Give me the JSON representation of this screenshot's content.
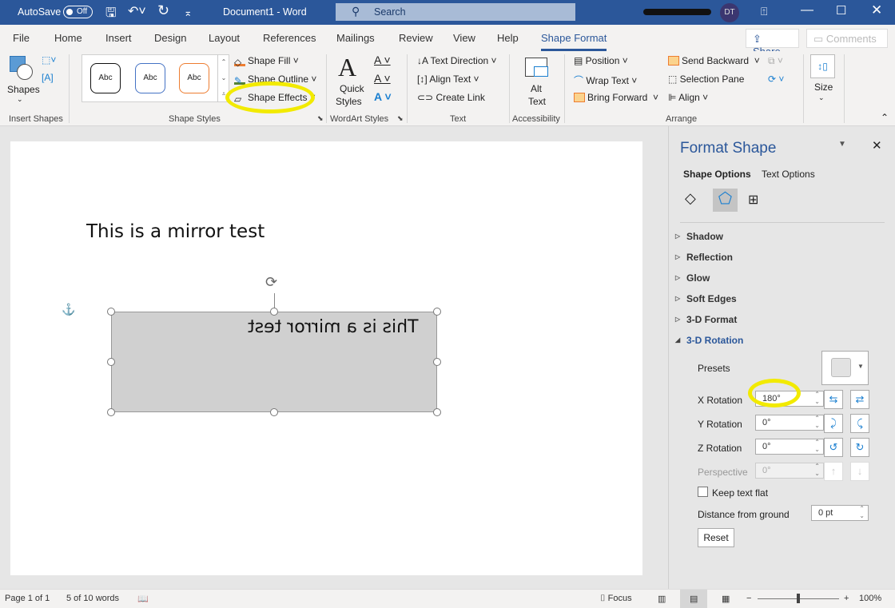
{
  "titlebar": {
    "autosave": "AutoSave",
    "autosave_state": "Off",
    "doc_title": "Document1  -  Word",
    "search_placeholder": "Search",
    "user_initials": "DT"
  },
  "tabs": [
    {
      "label": "File"
    },
    {
      "label": "Home"
    },
    {
      "label": "Insert"
    },
    {
      "label": "Design"
    },
    {
      "label": "Layout"
    },
    {
      "label": "References"
    },
    {
      "label": "Mailings"
    },
    {
      "label": "Review"
    },
    {
      "label": "View"
    },
    {
      "label": "Help"
    },
    {
      "label": "Shape Format",
      "active": true
    }
  ],
  "share": "Share",
  "comments": "Comments",
  "ribbon": {
    "insert_shapes": {
      "shapes": "Shapes",
      "group": "Insert Shapes"
    },
    "shape_styles": {
      "samples": [
        "Abc",
        "Abc",
        "Abc"
      ],
      "fill": "Shape Fill",
      "outline": "Shape Outline",
      "effects": "Shape Effects",
      "group": "Shape Styles"
    },
    "wordart": {
      "quick_styles_1": "Quick",
      "quick_styles_2": "Styles",
      "group": "WordArt Styles"
    },
    "text": {
      "direction": "Text Direction",
      "align": "Align Text",
      "link": "Create Link",
      "group": "Text"
    },
    "accessibility": {
      "alt1": "Alt",
      "alt2": "Text",
      "group": "Accessibility"
    },
    "arrange": {
      "position": "Position",
      "wrap": "Wrap Text",
      "forward": "Bring Forward",
      "backward": "Send Backward",
      "selection": "Selection Pane",
      "align": "Align",
      "group": "Arrange"
    },
    "size": {
      "label": "Size"
    }
  },
  "document": {
    "text": "This is a mirror test",
    "shape_text": "This is a mirror test"
  },
  "pane": {
    "title": "Format Shape",
    "tab_shape": "Shape Options",
    "tab_text": "Text Options",
    "sections": [
      "Shadow",
      "Reflection",
      "Glow",
      "Soft Edges",
      "3-D Format",
      "3-D Rotation"
    ],
    "presets": "Presets",
    "x_rotation": "X Rotation",
    "x_value": "180°",
    "y_rotation": "Y Rotation",
    "y_value": "0°",
    "z_rotation": "Z Rotation",
    "z_value": "0°",
    "perspective": "Perspective",
    "perspective_value": "0°",
    "keep_flat": "Keep text flat",
    "keep_flat_checked": false,
    "distance": "Distance from ground",
    "distance_value": "0 pt",
    "reset": "Reset"
  },
  "status": {
    "page": "Page 1 of 1",
    "words": "5 of 10 words",
    "focus": "Focus",
    "zoom": "100%",
    "zoom_percent": 100
  },
  "colors": {
    "title_bar": "#2b579a",
    "highlight": "#f2ea00",
    "accent": "#2b579a"
  }
}
